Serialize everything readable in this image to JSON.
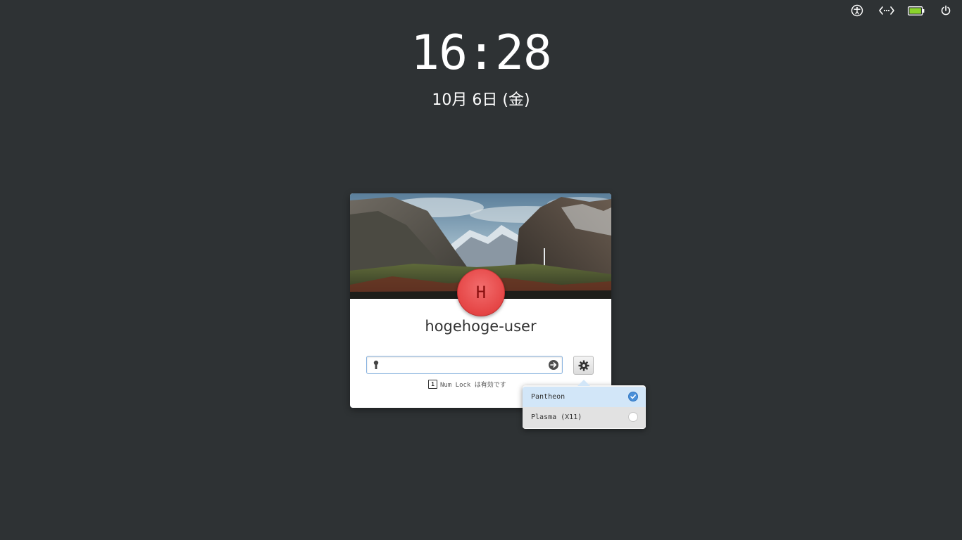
{
  "topbar": {
    "icons": [
      "accessibility-icon",
      "network-icon",
      "battery-icon",
      "power-icon"
    ],
    "battery_color": "#8ad32c"
  },
  "clock": {
    "time": "16:28",
    "date": "10月 6日 (金)"
  },
  "login": {
    "avatar_initial": "H",
    "avatar_color": "#e54545",
    "username": "hogehoge-user",
    "password_value": "",
    "numlock_badge": "1",
    "numlock_text": "Num Lock は有効です"
  },
  "sessions": {
    "items": [
      {
        "label": "Pantheon",
        "selected": true
      },
      {
        "label": "Plasma (X11)",
        "selected": false
      }
    ],
    "accent": "#4a90d9"
  }
}
